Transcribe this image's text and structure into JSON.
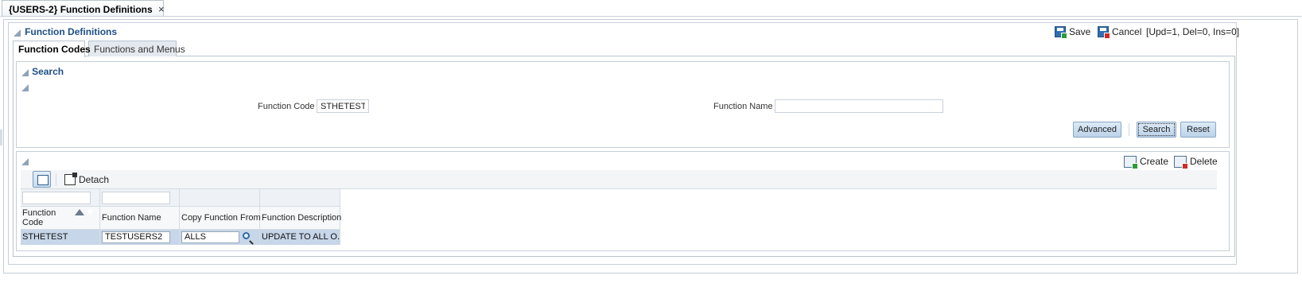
{
  "document_tab": {
    "title": "{USERS-2} Function Definitions",
    "close_glyph": "×"
  },
  "page_header": {
    "title": "Function Definitions"
  },
  "toolbar": {
    "save_label": "Save",
    "cancel_label": "Cancel",
    "update_info": "[Upd=1, Del=0, Ins=0]"
  },
  "tabs": [
    {
      "label": "Function Codes",
      "active": true
    },
    {
      "label": "Functions and Menus",
      "active": false
    }
  ],
  "search": {
    "title": "Search",
    "function_code_label": "Function Code",
    "function_code_value": "STHETEST",
    "function_name_label": "Function Name",
    "function_name_value": "",
    "advanced_label": "Advanced",
    "search_label": "Search",
    "reset_label": "Reset"
  },
  "results": {
    "detach_label": "Detach",
    "create_label": "Create",
    "delete_label": "Delete",
    "columns": [
      {
        "header": "Function Code",
        "sorted": "ascending"
      },
      {
        "header": "Function Name"
      },
      {
        "header": "Copy Function From"
      },
      {
        "header": "Function Description"
      }
    ],
    "rows": [
      {
        "function_code": "STHETEST",
        "function_name": "TESTUSERS2",
        "copy_function_from": "ALLS",
        "function_description": "UPDATE TO ALL O..."
      }
    ]
  },
  "icons": {
    "save": "save-icon",
    "cancel": "cancel-icon",
    "detach": "detach-icon",
    "create": "create-icon",
    "delete": "delete-icon",
    "lookup": "magnifier-icon",
    "select_mode": "select-mode-icon"
  },
  "colors": {
    "header_title": "#1d4f86",
    "selected_row": "#c7d6e8",
    "button_gradient_top": "#dceaf6",
    "button_gradient_bottom": "#bcd3ea"
  }
}
